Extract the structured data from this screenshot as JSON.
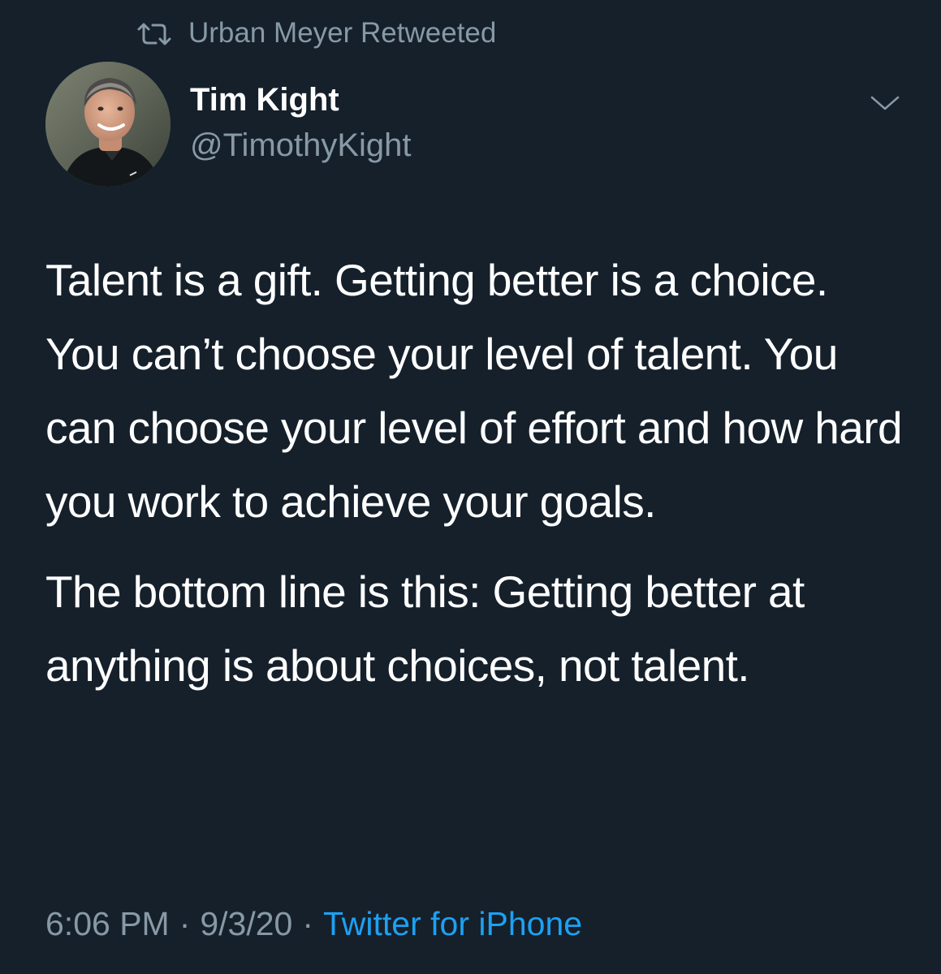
{
  "retweet": {
    "icon": "retweet-icon",
    "text": "Urban Meyer Retweeted"
  },
  "author": {
    "display_name": "Tim Kight",
    "handle": "@TimothyKight",
    "avatar_icon": "avatar-photo"
  },
  "menu": {
    "icon": "chevron-down-icon"
  },
  "tweet": {
    "paragraphs": [
      "Talent is a gift. Getting better is a choice. You can’t choose your level of talent. You can choose your level of effort and how hard you work to achieve your goals.",
      "The bottom line is this: Getting better at anything is about choices, not talent."
    ]
  },
  "meta": {
    "time": "6:06 PM",
    "separator": "·",
    "date": "9/3/20",
    "source": "Twitter for iPhone"
  },
  "colors": {
    "background": "#15202b",
    "primary_text": "#ffffff",
    "secondary_text": "#8899a6",
    "link": "#1da1f2"
  }
}
